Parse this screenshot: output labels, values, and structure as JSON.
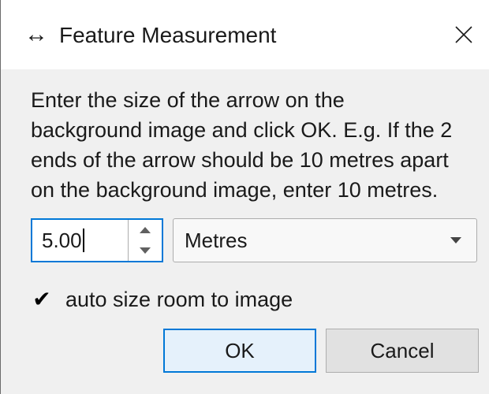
{
  "window": {
    "title": "Feature Measurement",
    "title_icon": "left-right-arrow-icon",
    "close_icon": "close-icon"
  },
  "description": "Enter the size of the arrow on the\nbackground image and click OK. E.g. If the 2\nends of the arrow should be 10 metres apart\non the background image, enter 10 metres.",
  "size_input": {
    "value": "5.00"
  },
  "unit_select": {
    "selected": "Metres"
  },
  "auto_size_checkbox": {
    "checked": true,
    "check_glyph": "✔",
    "label": "auto size room to image"
  },
  "buttons": {
    "ok_label": "OK",
    "cancel_label": "Cancel"
  },
  "colors": {
    "focus_accent": "#0078d7",
    "dialog_background": "#f0f0f0",
    "titlebar_background": "#ffffff"
  }
}
